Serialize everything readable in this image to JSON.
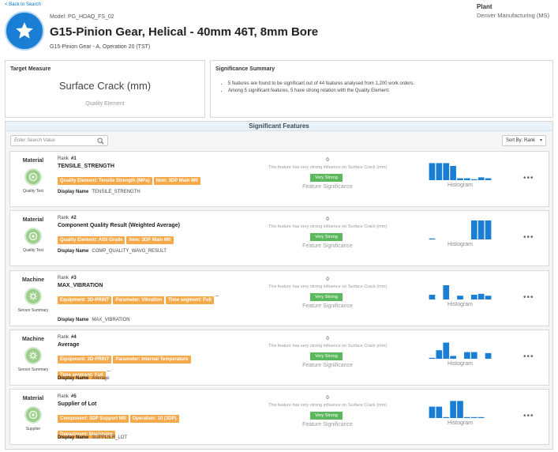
{
  "nav": {
    "back_label": "< Back to Search"
  },
  "header": {
    "model": "Model: PG_HDAQ_FS_02",
    "title": "G15-Pinion Gear, Helical - 40mm 46T, 8mm Bore",
    "subtitle": "G15-Pinion Gear - A, Operation 20 (TST)",
    "plant_label": "Plant",
    "plant_value": "Denver Manufacturing (MS)"
  },
  "target": {
    "title": "Target Measure",
    "value": "Surface Crack (mm)",
    "sub": "Quality Element"
  },
  "summary": {
    "title": "Significance Summary",
    "items": [
      "5 features are found to be significant out of 44 features analysed from 1,200 work orders.",
      "Among 5 significant features, 5 have strong relation with the Quality Element."
    ]
  },
  "features": {
    "header": "Significant Features",
    "search_placeholder": "Enter Search Value",
    "sort_label": "Sort By: Rank",
    "rank_prefix": "Rank",
    "display_name_label": "Display Name",
    "sig_caption": "Feature Significance",
    "hist_caption": "Histogram",
    "items": [
      {
        "category": "Material",
        "category_sub": "Quality Test",
        "rank": "#1",
        "name": "TENSILE_STRENGTH",
        "tags": [
          "Quality Element: Tensile Strength (MPa)",
          "Item: 3DP Main Mtl"
        ],
        "dash": "",
        "display_name": "TENSILE_STRENGTH",
        "sig_value": "0",
        "sig_desc": "This feature has very strong influence on Surface Crack (mm)",
        "badge": "Very Strong",
        "histogram": [
          0.9,
          0.9,
          0.9,
          0.75,
          0.1,
          0.1,
          0.05,
          0.15,
          0.1
        ]
      },
      {
        "category": "Material",
        "category_sub": "Quality Test",
        "rank": "#2",
        "name": "Component Quality Result (Weighted Average)",
        "tags": [
          "Quality Element: AISI Grade",
          "Item: 3DP Main Mtl"
        ],
        "dash": "",
        "display_name": "COMP_QUALITY_WAVG_RESULT",
        "sig_value": "0",
        "sig_desc": "This feature has very strong influence on Surface Crack (mm)",
        "badge": "Very Strong",
        "histogram": [
          0.05,
          0,
          0,
          0,
          0,
          0,
          1,
          1,
          1
        ]
      },
      {
        "category": "Machine",
        "category_sub": "Sensor Summary",
        "rank": "#3",
        "name": "MAX_VIBRATION",
        "tags": [
          "Equipment: 3D-PRINT",
          "Parameter: Vibration",
          "Time segment: Full"
        ],
        "dash": "_",
        "display_name": "MAX_VIBRATION",
        "sig_value": "0",
        "sig_desc": "This feature has very strong influence on Surface Crack (mm)",
        "badge": "Very Strong",
        "histogram": [
          0.25,
          0,
          0.75,
          0,
          0.2,
          0,
          0.25,
          0.3,
          0.2
        ]
      },
      {
        "category": "Machine",
        "category_sub": "Sensor Summary",
        "rank": "#4",
        "name": "Average",
        "tags": [
          "Equipment: 3D-PRINT",
          "Parameter: Internal Temperature",
          "Time segment: Full"
        ],
        "dash": "_",
        "display_name": "Average",
        "sig_value": "0",
        "sig_desc": "This feature has very strong influence on Surface Crack (mm)",
        "badge": "Very Strong",
        "histogram": [
          0.05,
          0.45,
          0.85,
          0.15,
          0,
          0.35,
          0.35,
          0,
          0.3
        ]
      },
      {
        "category": "Material",
        "category_sub": "Supplier",
        "rank": "#5",
        "name": "Supplier of Lot",
        "tags": [
          "Component: 3DP Support Mtl",
          "Operation: 10 (3DP)",
          "Department: Machining"
        ],
        "dash": "",
        "display_name": "SUPPLIER_LOT",
        "sig_value": "0",
        "sig_desc": "This feature has very strong influence on Surface Crack (mm)",
        "badge": "Very Strong",
        "histogram": [
          0.6,
          0.6,
          0.05,
          0.9,
          0.9,
          0.05,
          0.05,
          0.05,
          0
        ]
      }
    ]
  },
  "colors": {
    "accent": "#1a7fd4",
    "badge": "#5cb85c",
    "tag": "#f5a94a",
    "category_icon": "#9ccf8a",
    "histogram_bar": "#1a7fd4"
  }
}
